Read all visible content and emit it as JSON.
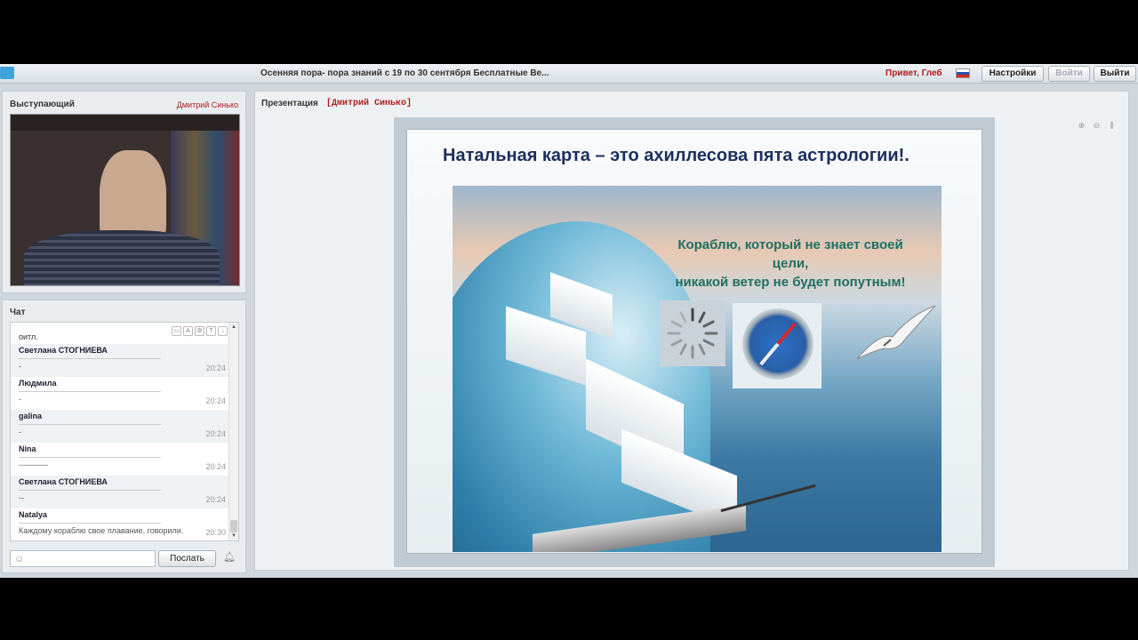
{
  "topbar": {
    "title": "Осенняя пора- пора знаний с 19 по 30 сентября Бесплатные Ве...",
    "greeting": "Привет, Глеб",
    "settings_label": "Настройки",
    "login_label": "Войти",
    "logout_label": "Выйти"
  },
  "presenter": {
    "label": "Выступающий",
    "name": "Дмитрий Синько"
  },
  "chat": {
    "label": "Чат",
    "first_line": "оитл.",
    "messages": [
      {
        "name": "Светлана СТОГНИЕВА",
        "text": "-",
        "time": "20:24"
      },
      {
        "name": "Людмила",
        "text": "-",
        "time": "20:24"
      },
      {
        "name": "galina",
        "text": "-",
        "time": "20:24"
      },
      {
        "name": "Nina",
        "text": "-----------",
        "time": "20:24"
      },
      {
        "name": "Светлана СТОГНИЕВА",
        "text": "--",
        "time": "20:24"
      },
      {
        "name": "Natalya",
        "text": "Каждому кораблю свое плавание, говорили.",
        "time": "20:30"
      }
    ],
    "send_label": "Послать"
  },
  "presentation": {
    "label": "Презентация",
    "owner": "[Дмитрий Синько]",
    "slide_title": "Натальная карта – это ахиллесова пята астрологии!.",
    "quote_line1": "Кораблю, который не знает своей",
    "quote_line2": "цели,",
    "quote_line3": "никакой ветер не будет попутным!"
  },
  "colors": {
    "accent_red": "#b01c1c",
    "slide_title": "#1d2f5c",
    "quote": "#1f6f64"
  },
  "icons": {
    "zoom_in": "zoom-in-icon",
    "zoom_out": "zoom-out-icon",
    "fit": "fit-icon",
    "bell": "bell-icon",
    "smile": "smile-icon"
  }
}
